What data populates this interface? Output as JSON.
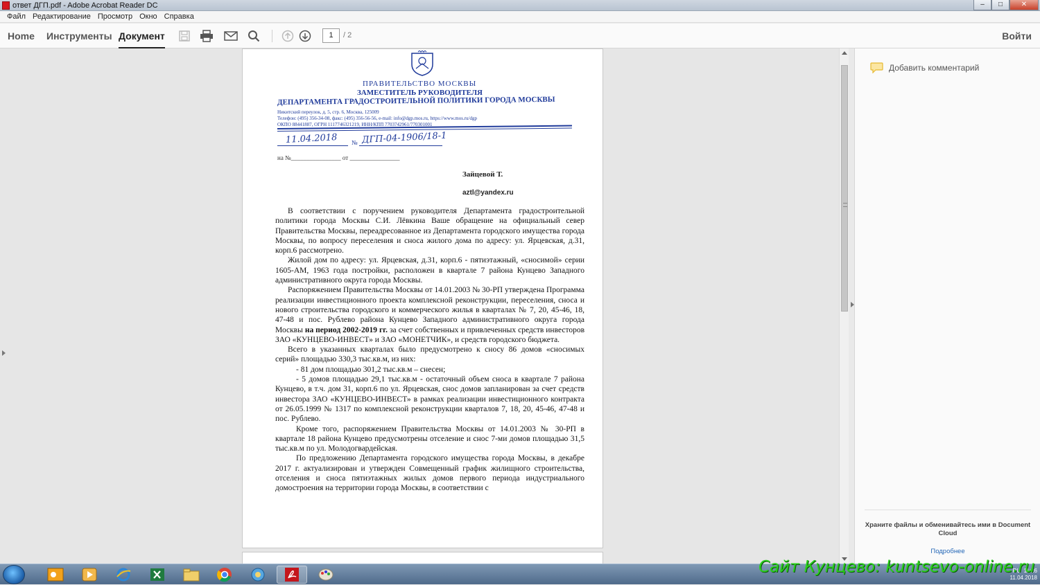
{
  "window": {
    "title": "ответ ДГП.pdf - Adobe Acrobat Reader DC",
    "buttons": {
      "minimize": "–",
      "maximize": "□",
      "close": "✕"
    }
  },
  "menu": [
    "Файл",
    "Редактирование",
    "Просмотр",
    "Окно",
    "Справка"
  ],
  "toolbar": {
    "tabs": [
      "Home",
      "Инструменты",
      "Документ"
    ],
    "active_tab": "Документ",
    "icons": [
      "save-icon",
      "print-icon",
      "mail-icon",
      "search-icon",
      "page-up-icon",
      "page-down-icon"
    ],
    "current_page": "1",
    "total_pages": "/ 2",
    "login": "Войти"
  },
  "letter": {
    "government": "ПРАВИТЕЛЬСТВО МОСКВЫ",
    "deputy": "ЗАМЕСТИТЕЛЬ РУКОВОДИТЕЛЯ",
    "department": "ДЕПАРТАМЕНТА ГРАДОСТРОИТЕЛЬНОЙ ПОЛИТИКИ ГОРОДА МОСКВЫ",
    "address": "Никитский переулок, д. 5, стр. 6, Москва, 125009",
    "phones": "Телефон: (495) 356-34-08, факс: (495) 356-56-56, e-mail: info@dgp.mos.ru, https://www.mos.ru/dgp",
    "codes": "ОКПО 88441887, ОГРН 1117746321219, ИНН/КПП 7703742961/770301001",
    "date_handwritten": "11.04.2018",
    "number_label": "№",
    "number_handwritten": "ДГП-04-1906/18-1",
    "reference_line": "на №________________ от ________________",
    "addressee": "Зайцевой Т.",
    "email": "aztl@yandex.ru",
    "paragraphs": [
      "В соответствии с поручением руководителя Департамента градостроительной политики города Москвы С.И. Лёвкина Ваше обращение на официальный север Правительства Москвы, переадресованное из Департамента городского имущества города Москвы, по вопросу переселения и сноса жилого дома по адресу: ул. Ярцевская, д.31, корп.6 рассмотрено.",
      "Жилой дом по адресу: ул. Ярцевская, д.31, корп.6 - пятиэтажный, «сносимой» серии 1605-АМ, 1963 года постройки, расположен в квартале 7 района Кунцево Западного административного округа города Москвы."
    ],
    "p3_before": "Распоряжением Правительства Москвы от 14.01.2003 № 30-РП утверждена Программа реализации инвестиционного проекта комплексной реконструкции, переселения, сноса и нового строительства городского и коммерческого жилья в кварталах № 7, 20, 45-46, 18, 47-48 и пос. Рублево района Кунцево Западного административного округа города Москвы ",
    "p3_bold": "на период 2002-2019 гг.",
    "p3_after": " за счет собственных и привлеченных средств инвесторов ЗАО «КУНЦЕВО-ИНВЕСТ» и ЗАО «МОНЕТЧИК», и средств городского бюджета.",
    "p4": "Всего в указанных кварталах было предусмотрено к сносу 86 домов «сносимых серий» площадью 330,3 тыс.кв.м, из них:",
    "p5": "- 81 дом площадью 301,2 тыс.кв.м – снесен;",
    "p6": "- 5 домов площадью 29,1 тыс.кв.м - остаточный объем сноса в квартале 7 района Кунцево, в т.ч. дом 31, корп.6 по ул. Ярцевская, снос домов запланирован за счет средств инвестора ЗАО «КУНЦЕВО-ИНВЕСТ» в рамках реализации инвестиционного контракта от 26.05.1999 № 1317 по комплексной реконструкции кварталов 7, 18, 20, 45-46, 47-48 и пос. Рублево.",
    "p7": "Кроме того, распоряжением Правительства Москвы от 14.01.2003 № 30-РП в квартале 18 района Кунцево предусмотрены отселение и снос 7-ми домов площадью 31,5 тыс.кв.м по ул. Молодогвардейская.",
    "p8": "По предложению Департамента городского имущества города Москвы, в декабре 2017 г. актуализирован и утвержден Совмещенный график жилищного строительства, отселения и сноса пятиэтажных жилых домов первого периода индустриального домостроения на территории города Москвы, в соответствии с"
  },
  "right_pane": {
    "add_comment": "Добавить комментарий",
    "cloud_text": "Храните файлы и обменивайтесь ими в Document Cloud",
    "cloud_link": "Подробнее"
  },
  "taskbar": {
    "time": "11:26",
    "date": "11.04.2018",
    "lang": "RU"
  },
  "watermark": "Сайт Кунцево:  kuntsevo-online.ru",
  "colors": {
    "letterhead_blue": "#1f3a9a",
    "acrobat_red": "#d71920",
    "watermark_green": "#2bd01e"
  }
}
